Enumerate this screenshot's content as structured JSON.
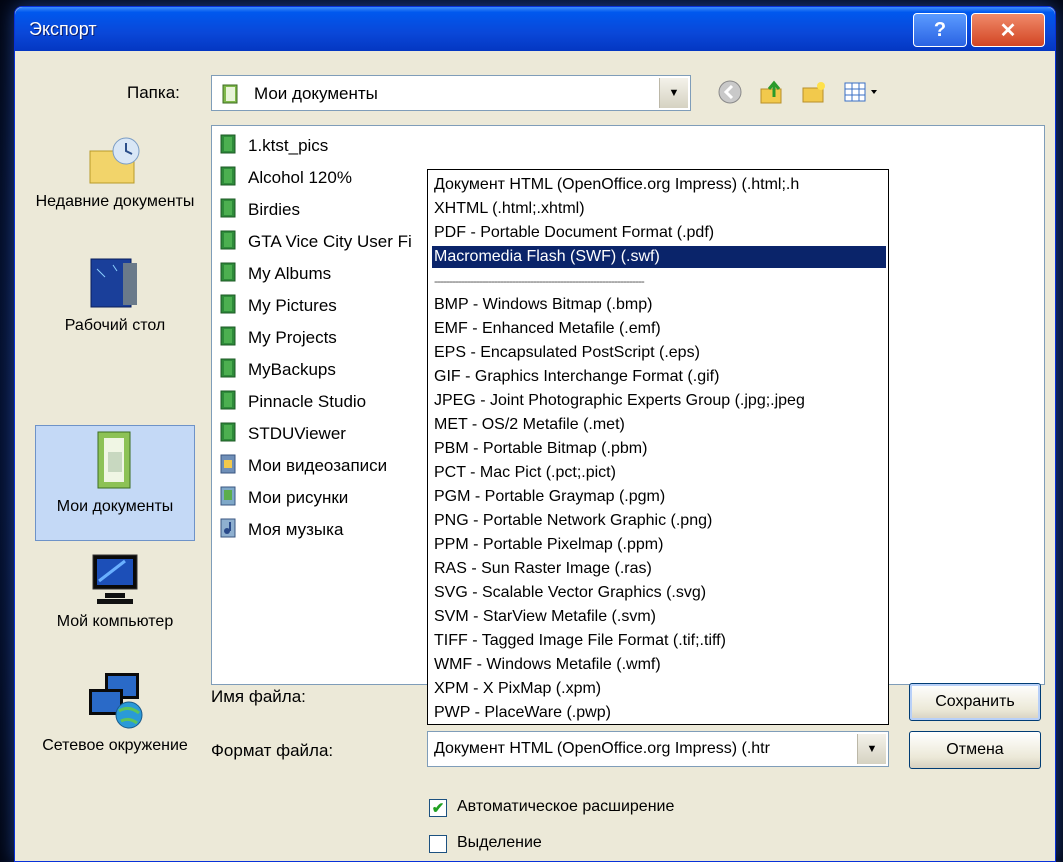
{
  "window": {
    "title": "Экспорт",
    "help_button": "?",
    "close_button": "✕"
  },
  "folder": {
    "label": "Папка:",
    "current": "Мои документы"
  },
  "places": [
    {
      "name": "place-recent",
      "label": "Недавние документы",
      "icon": "recent-documents-icon"
    },
    {
      "name": "place-desktop",
      "label": "Рабочий стол",
      "icon": "desktop-icon"
    },
    {
      "name": "place-my-documents",
      "label": "Мои документы",
      "icon": "my-documents-icon",
      "selected": true
    },
    {
      "name": "place-my-computer",
      "label": "Мой компьютер",
      "icon": "my-computer-icon"
    },
    {
      "name": "place-network",
      "label": "Сетевое окружение",
      "icon": "network-icon"
    }
  ],
  "files": [
    "1.ktst_pics",
    "Alcohol 120%",
    "Birdies",
    "GTA Vice City User Fi",
    "My Albums",
    "My Pictures",
    "My Projects",
    "MyBackups",
    "Pinnacle Studio",
    "STDUViewer",
    "Мои видеозаписи",
    "Мои рисунки",
    "Моя музыка"
  ],
  "format_options": [
    "Документ HTML (OpenOffice.org Impress) (.html;.h",
    "XHTML (.html;.xhtml)",
    "PDF - Portable Document Format (.pdf)",
    "Macromedia Flash (SWF) (.swf)",
    "----------------------------------------------------------------------",
    "BMP - Windows Bitmap (.bmp)",
    "EMF - Enhanced Metafile (.emf)",
    "EPS - Encapsulated PostScript (.eps)",
    "GIF - Graphics Interchange Format (.gif)",
    "JPEG - Joint Photographic Experts Group (.jpg;.jpeg",
    "MET - OS/2 Metafile (.met)",
    "PBM - Portable Bitmap (.pbm)",
    "PCT - Mac Pict (.pct;.pict)",
    "PGM - Portable Graymap (.pgm)",
    "PNG - Portable Network Graphic (.png)",
    "PPM - Portable Pixelmap (.ppm)",
    "RAS - Sun Raster Image (.ras)",
    "SVG - Scalable Vector Graphics (.svg)",
    "SVM - StarView Metafile (.svm)",
    "TIFF - Tagged Image File Format (.tif;.tiff)",
    "WMF - Windows Metafile (.wmf)",
    "XPM - X PixMap (.xpm)",
    "PWP - PlaceWare (.pwp)"
  ],
  "selected_option_index": 3,
  "filename": {
    "label": "Имя файла:",
    "value": ""
  },
  "format": {
    "label": "Формат файла:",
    "value": "Документ HTML (OpenOffice.org Impress) (.htr"
  },
  "buttons": {
    "save": "Сохранить",
    "cancel": "Отмена"
  },
  "checkboxes": [
    {
      "label": "Автоматическое расширение",
      "checked": true
    },
    {
      "label": "Выделение",
      "checked": false
    }
  ],
  "colors": {
    "titlebar": "#0a47d8",
    "selection": "#0a246a",
    "folder_icon": "#2e8b3a"
  }
}
